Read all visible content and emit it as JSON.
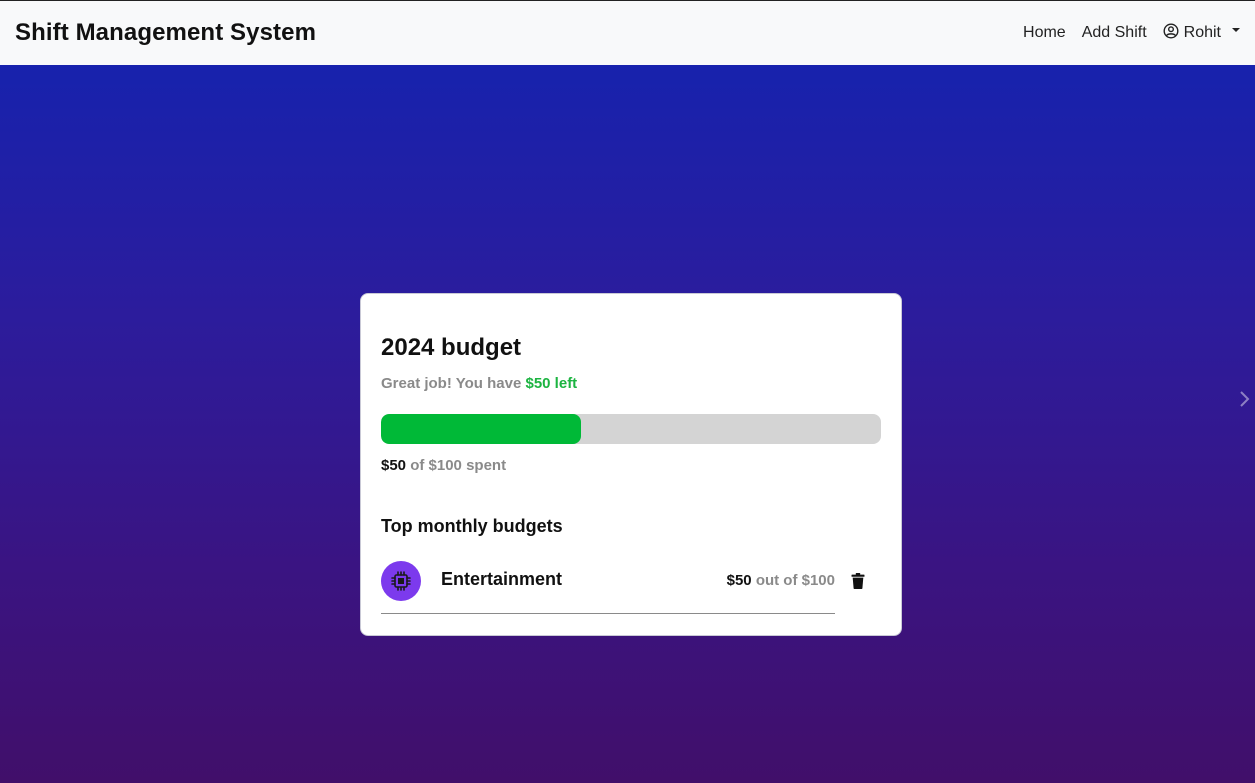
{
  "navbar": {
    "brand": "Shift Management System",
    "links": [
      "Home",
      "Add Shift"
    ],
    "user": "Rohit"
  },
  "budget_card": {
    "title": "2024 budget",
    "subtitle_prefix": "Great job! You have",
    "subtitle_highlight": "$50 left",
    "progress_fraction": 0.4,
    "spent_amount": "$50",
    "spent_rest": "of $100 spent",
    "section_title": "Top monthly budgets",
    "items": [
      {
        "name": "Entertainment",
        "spent": "$50",
        "rest": "out of $100",
        "icon": "cpu-chip-icon"
      }
    ]
  },
  "colors": {
    "accent_green": "#00b937",
    "icon_purple": "#7c3aed",
    "track_gray": "#d4d4d4",
    "gradient_top": "#1722ad",
    "gradient_bottom": "#410f6a"
  }
}
